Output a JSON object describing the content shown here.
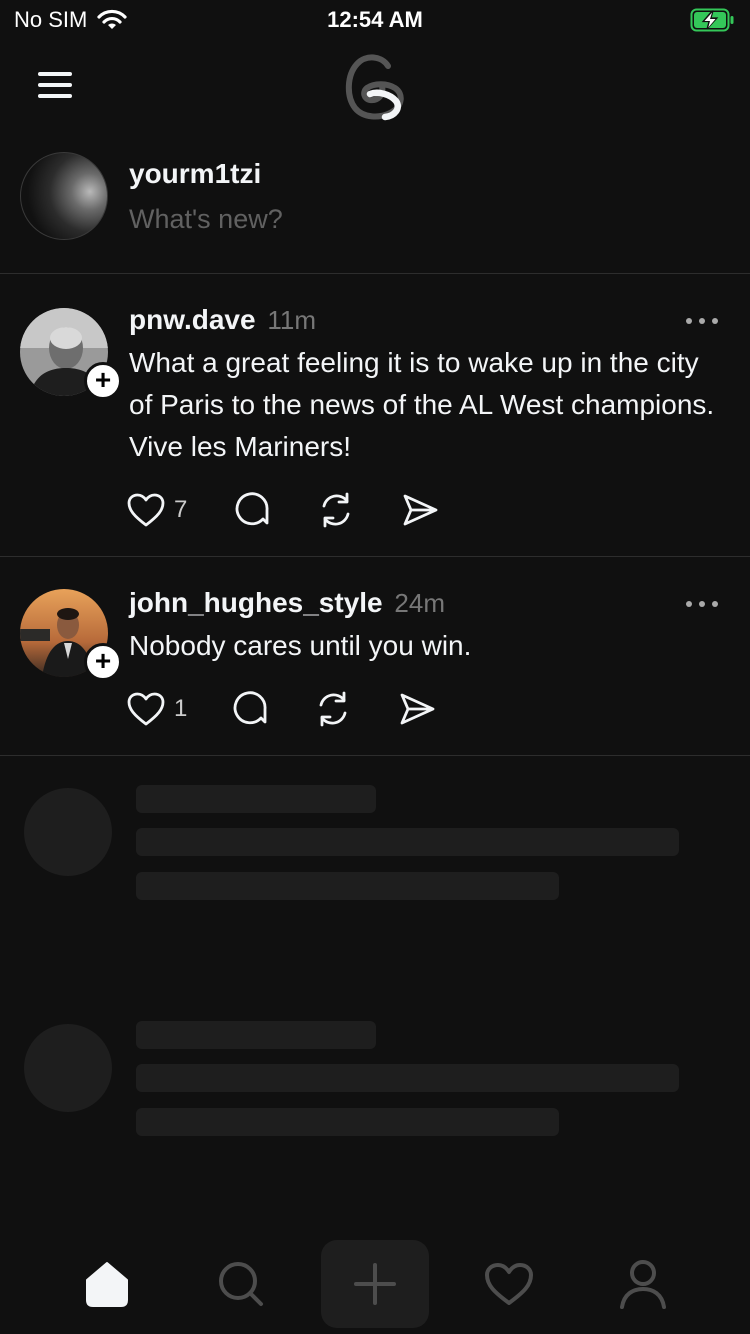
{
  "status_bar": {
    "carrier": "No SIM",
    "time": "12:54 AM",
    "battery_color": "#34c759"
  },
  "header": {
    "menu_icon": "menu-icon",
    "logo_icon": "threads-logo-icon"
  },
  "composer": {
    "username": "yourm1tzi",
    "placeholder": "What's new?"
  },
  "posts": [
    {
      "author": "pnw.dave",
      "time": "11m",
      "text": "What a great feeling it is to wake up in the city of Paris to the news of the AL West champions. Vive les Mariners!",
      "likes": "7"
    },
    {
      "author": "john_hughes_style",
      "time": "24m",
      "text": "Nobody cares until you win.",
      "likes": "1"
    }
  ],
  "tabbar": {
    "items": [
      "home-icon",
      "search-icon",
      "create-icon",
      "activity-icon",
      "profile-icon"
    ]
  },
  "colors": {
    "background": "#101010",
    "text_primary": "#f3f5f7",
    "text_secondary": "#777777",
    "placeholder": "#616161",
    "divider": "#2d2d2d",
    "skeleton": "#1e1e1e"
  }
}
